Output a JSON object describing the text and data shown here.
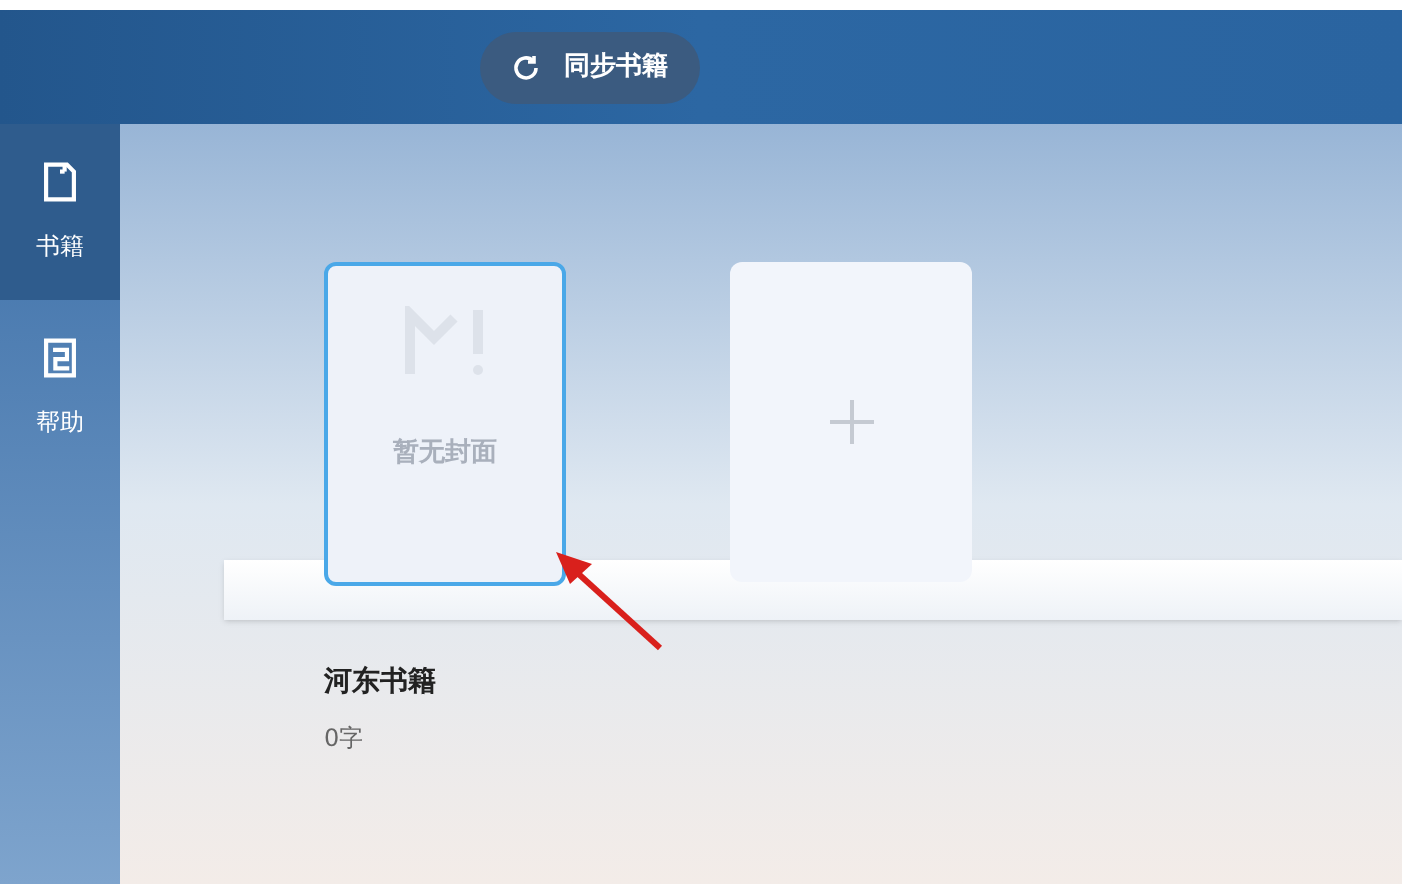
{
  "toolbar": {
    "sync_button": "同步书籍"
  },
  "sidebar": {
    "items": [
      {
        "label": "书籍",
        "kind": "book",
        "selected": true
      },
      {
        "label": "帮助",
        "kind": "help",
        "selected": false
      }
    ]
  },
  "shelf": {
    "books": [
      {
        "cover_text": "暂无封面",
        "title": "河东书籍",
        "word_count": "0字",
        "selected": true
      }
    ]
  }
}
